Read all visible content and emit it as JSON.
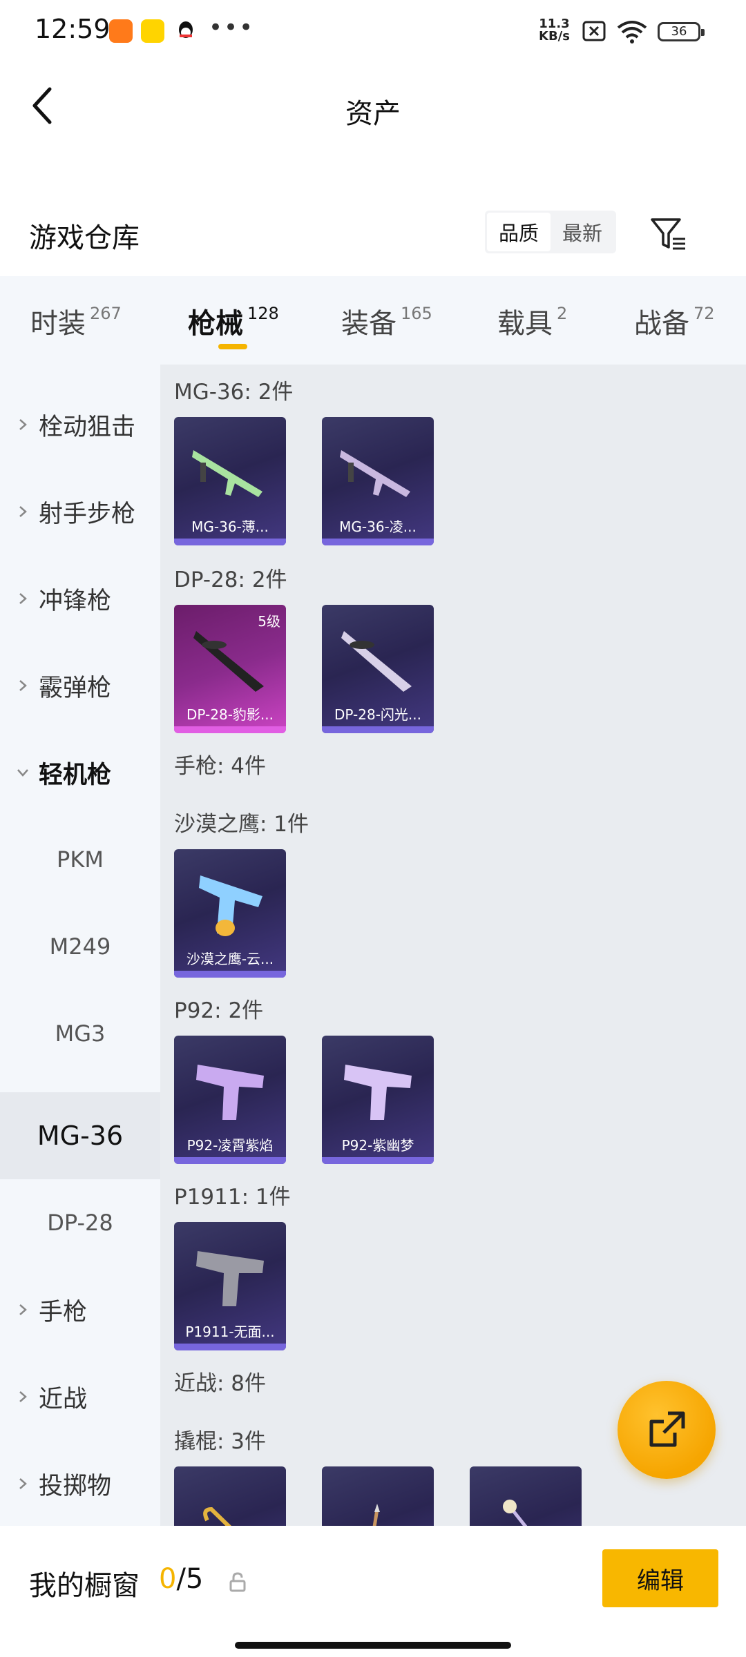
{
  "status_bar": {
    "time": "12:59",
    "net_speed_value": "11.3",
    "net_speed_unit": "KB/s",
    "battery": "36",
    "notification_icons": [
      "taobao-icon",
      "game-app-icon",
      "qq-icon"
    ],
    "more": "•••"
  },
  "nav": {
    "title": "资产"
  },
  "warehouse": {
    "title": "游戏仓库",
    "sort_options": [
      "品质",
      "最新"
    ],
    "sort_selected": "品质"
  },
  "tabs": [
    {
      "label": "时装",
      "count": "267"
    },
    {
      "label": "枪械",
      "count": "128",
      "active": true
    },
    {
      "label": "装备",
      "count": "165"
    },
    {
      "label": "载具",
      "count": "2"
    },
    {
      "label": "战备",
      "count": "72"
    }
  ],
  "sidebar": {
    "categories": [
      {
        "label": "栓动狙击"
      },
      {
        "label": "射手步枪"
      },
      {
        "label": "冲锋枪"
      },
      {
        "label": "霰弹枪"
      },
      {
        "label": "轻机枪",
        "expanded": true
      },
      {
        "label": "手枪"
      },
      {
        "label": "近战"
      },
      {
        "label": "投掷物"
      }
    ],
    "subitems": [
      "PKM",
      "M249",
      "MG3",
      "MG-36",
      "DP-28"
    ],
    "selected_sub": "MG-36"
  },
  "groups": [
    {
      "title": "MG-36: 2件",
      "items": [
        {
          "name": "MG-36-薄..."
        },
        {
          "name": "MG-36-凌..."
        }
      ]
    },
    {
      "title": "DP-28: 2件",
      "items": [
        {
          "name": "DP-28-豹影...",
          "level": "5级",
          "rarity": "pink"
        },
        {
          "name": "DP-28-闪光..."
        }
      ]
    },
    {
      "title": "手枪: 4件",
      "items": []
    },
    {
      "title": "沙漠之鹰: 1件",
      "items": [
        {
          "name": "沙漠之鹰-云..."
        }
      ]
    },
    {
      "title": "P92: 2件",
      "items": [
        {
          "name": "P92-凌霄紫焰"
        },
        {
          "name": "P92-紫幽梦"
        }
      ]
    },
    {
      "title": "P1911: 1件",
      "items": [
        {
          "name": "P1911-无面..."
        }
      ]
    },
    {
      "title": "近战: 8件",
      "items": []
    },
    {
      "title": "撬棍: 3件",
      "items": [
        {
          "name": ""
        },
        {
          "name": ""
        },
        {
          "name": ""
        }
      ]
    }
  ],
  "bottom": {
    "showcase_label": "我的橱窗",
    "showcase_current": "0",
    "showcase_total": "/5",
    "edit_label": "编辑"
  },
  "colors": {
    "accent": "#f5b400",
    "card_purple": "#2a2552",
    "card_pink": "#8a2b8c"
  }
}
